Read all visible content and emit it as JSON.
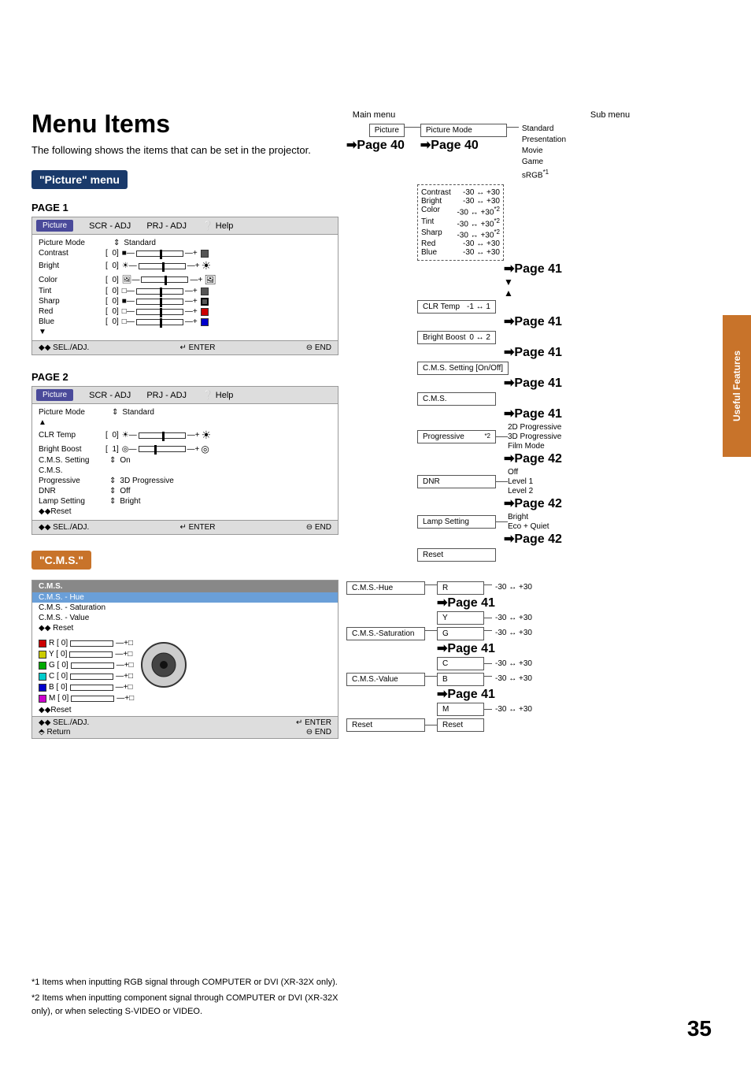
{
  "page": {
    "title": "Menu Items",
    "subtitle": "The following shows the items that can be set in the projector.",
    "page_number": "35",
    "right_tab": "Useful Features"
  },
  "picture_menu": {
    "label": "\"Picture\" menu",
    "page1_label": "PAGE 1",
    "page2_label": "PAGE 2",
    "tabs": [
      "Picture",
      "SCR - ADJ",
      "PRJ - ADJ",
      "Help"
    ],
    "page1_rows": [
      {
        "label": "Picture Mode",
        "value": "Standard",
        "type": "text"
      },
      {
        "label": "Contrast",
        "bracket": "[",
        "val": "0]",
        "type": "slider"
      },
      {
        "label": "Bright",
        "bracket": "[",
        "val": "0]",
        "type": "slider"
      },
      {
        "label": "Color",
        "bracket": "[",
        "val": "0]",
        "type": "slider"
      },
      {
        "label": "Tint",
        "bracket": "[",
        "val": "0]",
        "type": "slider"
      },
      {
        "label": "Sharp",
        "bracket": "[",
        "val": "0]",
        "type": "slider"
      },
      {
        "label": "Red",
        "bracket": "[",
        "val": "0]",
        "type": "slider"
      },
      {
        "label": "Blue",
        "bracket": "[",
        "val": "0]",
        "type": "slider"
      }
    ],
    "page1_footer": [
      "◆◆ SEL./ADJ.",
      "↵ ENTER",
      "⊟ END"
    ],
    "page2_rows": [
      {
        "label": "Picture Mode",
        "value": "Standard",
        "type": "text"
      },
      {
        "label": "CLR Temp",
        "bracket": "[",
        "val": "0]",
        "type": "slider"
      },
      {
        "label": "Bright Boost",
        "bracket": "[",
        "val": "1]",
        "type": "slider"
      },
      {
        "label": "C.M.S. Setting",
        "value": "On",
        "type": "text"
      },
      {
        "label": "C.M.S.",
        "value": "",
        "type": "text"
      },
      {
        "label": "Progressive",
        "value": "3D Progressive",
        "type": "text"
      },
      {
        "label": "DNR",
        "value": "Off",
        "type": "text"
      },
      {
        "label": "Lamp Setting",
        "value": "Bright",
        "type": "text"
      }
    ],
    "page2_reset": "◆◆Reset",
    "page2_footer": [
      "◆◆ SEL./ADJ.",
      "↵ ENTER",
      "⊟ END"
    ]
  },
  "cms_menu": {
    "label": "\"C.M.S.\"",
    "header": "C.M.S.",
    "items": [
      "C.M.S. - Hue",
      "C.M.S. - Saturation",
      "C.M.S. - Value"
    ],
    "reset": "◆◆ Reset",
    "color_rows": [
      {
        "color": "R",
        "val": "0]"
      },
      {
        "color": "Y",
        "val": "0]"
      },
      {
        "color": "G",
        "val": "0]"
      },
      {
        "color": "C",
        "val": "0]"
      },
      {
        "color": "B",
        "val": "0]"
      },
      {
        "color": "M",
        "val": "0]"
      }
    ],
    "footer_reset": "◆◆Reset",
    "footer": [
      "◆◆ SEL./ADJ.",
      "↵ ENTER ⊟ END",
      "↩ Return"
    ]
  },
  "right_column": {
    "main_menu_label": "Main menu",
    "sub_menu_label": "Sub menu",
    "picture_label": "Picture",
    "picture_page_ref": "➜Page 40",
    "picture_mode_label": "Picture Mode",
    "picture_mode_page": "➜Page 40",
    "picture_mode_sub": [
      "Standard",
      "Presentation",
      "Movie",
      "Game",
      "sRGB*1"
    ],
    "adjustments": [
      {
        "label": "Contrast",
        "range": "-30 ↔ +30"
      },
      {
        "label": "Bright",
        "range": "-30 ↔ +30"
      },
      {
        "label": "Color",
        "range": "-30 ↔ +30",
        "note": "*2"
      },
      {
        "label": "Tint",
        "range": "-30 ↔ +30",
        "note": "*2"
      },
      {
        "label": "Sharp",
        "range": "-30 ↔ +30",
        "note": "*2"
      },
      {
        "label": "Red",
        "range": "-30 ↔ +30"
      },
      {
        "label": "Blue",
        "range": "-30 ↔ +30"
      }
    ],
    "adj_page": "➜Page 41",
    "clr_temp_label": "CLR Temp",
    "clr_temp_range": "-1 ↔ 1",
    "clr_temp_page": "➜Page 41",
    "bright_boost_label": "Bright Boost",
    "bright_boost_range": "0 ↔ 2",
    "bright_boost_page": "➜Page 41",
    "cms_setting_label": "C.M.S. Setting [On/Off]",
    "cms_setting_page": "➜Page 41",
    "cms_label": "C.M.S.",
    "cms_page": "➜Page 41",
    "progressive_label": "Progressive",
    "progressive_note": "*2",
    "progressive_page": "➜Page 42",
    "progressive_sub": [
      "2D Progressive",
      "3D Progressive",
      "Film Mode"
    ],
    "dnr_label": "DNR",
    "dnr_page": "➜Page 42",
    "dnr_sub": [
      "Off",
      "Level 1",
      "Level 2"
    ],
    "lamp_label": "Lamp Setting",
    "lamp_page": "➜Page 42",
    "lamp_sub": [
      "Bright",
      "Eco + Quiet"
    ],
    "reset_label": "Reset",
    "cms_hue_label": "C.M.S.-Hue",
    "cms_hue_page": "➜Page 41",
    "cms_hue_sub": [
      {
        "color": "R",
        "range": "-30 ↔ +30"
      },
      {
        "color": "Y",
        "range": "-30 ↔ +30"
      },
      {
        "color": "G",
        "range": "-30 ↔ +30"
      },
      {
        "color": "C",
        "range": "-30 ↔ +30"
      },
      {
        "color": "B",
        "range": "-30 ↔ +30"
      },
      {
        "color": "M",
        "range": "-30 ↔ +30"
      }
    ],
    "cms_sat_label": "C.M.S.-Saturation",
    "cms_sat_page": "➜Page 41",
    "cms_val_label": "C.M.S.-Value",
    "cms_val_page": "➜Page 41",
    "cms_reset_label": "Reset",
    "cms_reset_sub": "Reset"
  },
  "footnotes": {
    "note1": "*1 Items when inputting RGB signal through COMPUTER or DVI (XR-32X only).",
    "note2": "*2 Items when inputting component signal through COMPUTER or DVI (XR-32X only), or when selecting S-VIDEO or VIDEO."
  }
}
